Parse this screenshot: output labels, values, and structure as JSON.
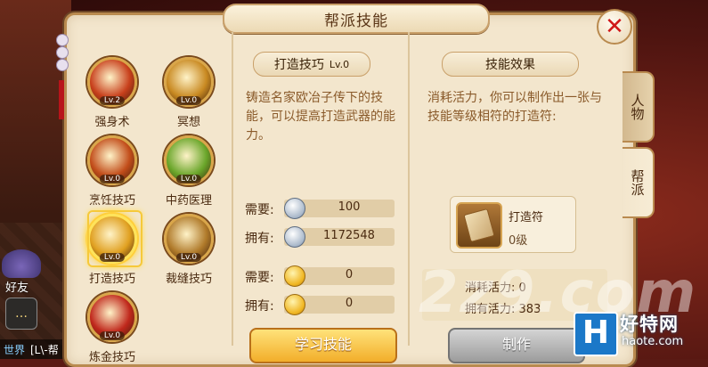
{
  "panel": {
    "title": "帮派技能",
    "close_label": "✕"
  },
  "skills": [
    {
      "name": "强身术",
      "level": "Lv.2",
      "icon": "body-strengthening-icon",
      "color": "#c8401c"
    },
    {
      "name": "冥想",
      "level": "Lv.0",
      "icon": "meditation-icon",
      "color": "#c98a22"
    },
    {
      "name": "烹饪技巧",
      "level": "Lv.0",
      "icon": "cooking-icon",
      "color": "#c24d1a"
    },
    {
      "name": "中药医理",
      "level": "Lv.0",
      "icon": "herbal-medicine-icon",
      "color": "#6aa62a"
    },
    {
      "name": "打造技巧",
      "level": "Lv.0",
      "icon": "forging-icon",
      "color": "#e0a020",
      "selected": true
    },
    {
      "name": "裁缝技巧",
      "level": "Lv.0",
      "icon": "tailoring-icon",
      "color": "#b07a2a"
    },
    {
      "name": "炼金技巧",
      "level": "Lv.0",
      "icon": "alchemy-icon",
      "color": "#c0281c"
    }
  ],
  "detail": {
    "skill_title": "打造技巧",
    "skill_level": "Lv.0",
    "description": "铸造名家欧冶子传下的技能，可以提高打造武器的能力。",
    "need_label": "需要:",
    "have_label": "拥有:",
    "silver_need": "100",
    "silver_have": "1172548",
    "gold_need": "0",
    "gold_have": "0",
    "learn_button": "学习技能"
  },
  "effect": {
    "title": "技能效果",
    "description": "消耗活力，你可以制作出一张与技能等级相符的打造符:",
    "item_name": "打造符",
    "item_level": "0级",
    "vitality_cost_label": "消耗活力:",
    "vitality_cost": "0",
    "vitality_have_label": "拥有活力:",
    "vitality_have": "383",
    "make_button": "制作"
  },
  "tabs": [
    {
      "label": "人物",
      "active": false
    },
    {
      "label": "帮派",
      "active": true
    }
  ],
  "hud": {
    "friends_label": "好友",
    "chat_channel": "世界",
    "chat_text": "[L\\-帮"
  },
  "watermark": {
    "text": "2z9.com",
    "logo_letter": "H",
    "logo_cn": "好特网",
    "logo_en": "haote.com"
  }
}
